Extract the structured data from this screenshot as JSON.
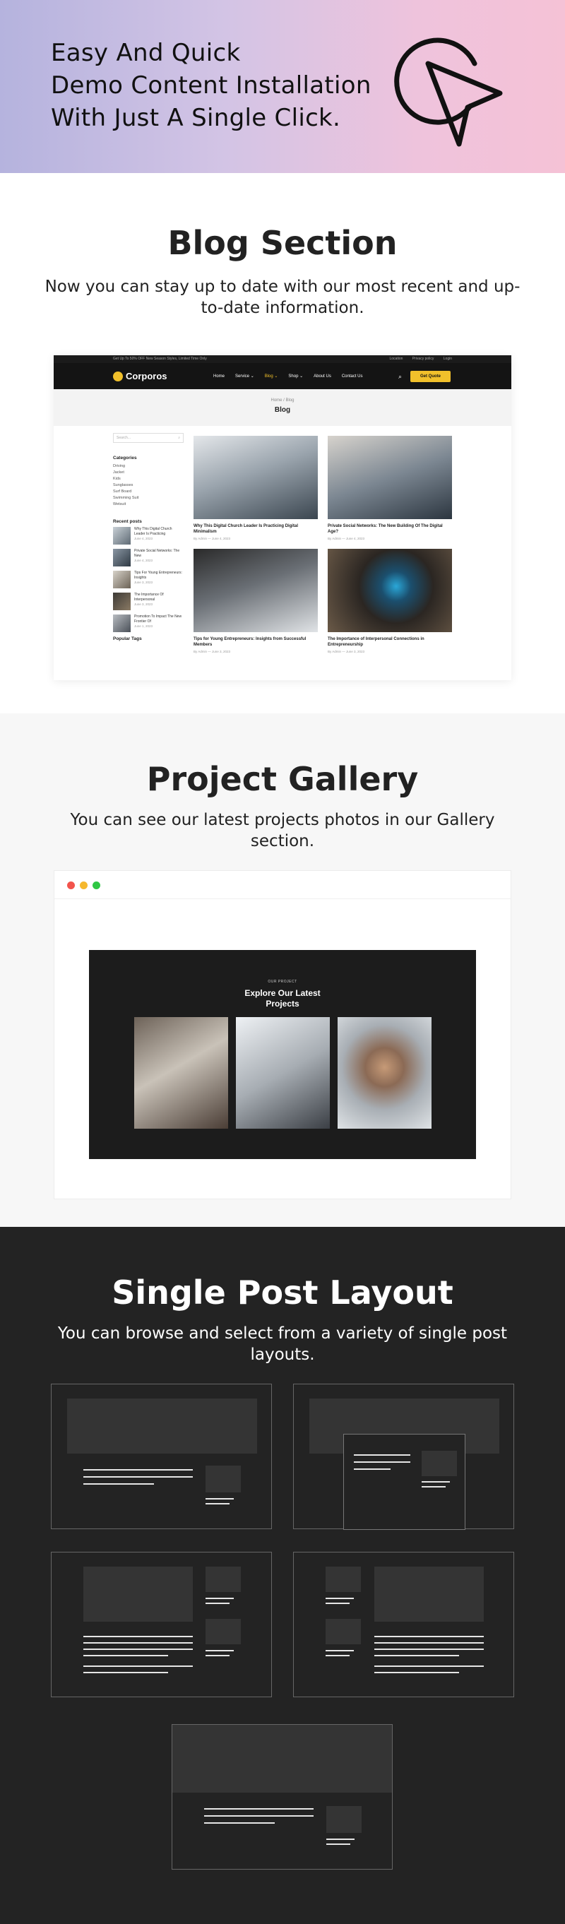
{
  "hero": {
    "title_lines": [
      "Easy And Quick",
      "Demo Content Installation",
      "With Just A Single Click."
    ],
    "icon": "cursor-click-icon"
  },
  "blog_section": {
    "title": "Blog Section",
    "subtitle": "Now you can stay up to date with our most recent and up-to-date information.",
    "preview": {
      "topbar_left": "Get Up To 50% OFF New Season Styles, Limited Time Only",
      "topbar_links": [
        "Location",
        "Privacy policy",
        "Login"
      ],
      "logo": "Corporos",
      "nav": [
        "Home",
        "Service ⌄",
        "Blog ⌄",
        "Shop ⌄",
        "About Us",
        "Contact Us"
      ],
      "nav_active": "Blog ⌄",
      "cta": "Get Quote",
      "breadcrumb": "Home / Blog",
      "page_title": "Blog",
      "search_placeholder": "Search...",
      "categories_title": "Categories",
      "categories": [
        "Driving",
        "Jacket",
        "Kids",
        "Sunglasses",
        "Surf Board",
        "Swimming Suit",
        "Wetsuit"
      ],
      "recent_title": "Recent posts",
      "recent_posts": [
        {
          "title": "Why This Digital Church Leader Is Practicing",
          "date": "June 4, 2023"
        },
        {
          "title": "Private Social Networks: The New",
          "date": "June 4, 2023"
        },
        {
          "title": "Tips For Young Entrepreneurs: Insights",
          "date": "June 3, 2023"
        },
        {
          "title": "The Importance Of Interpersonal",
          "date": "June 3, 2023"
        },
        {
          "title": "Promotion To Impact The New Frontier Of",
          "date": "June 1, 2023"
        }
      ],
      "popular_title": "Popular Tags",
      "posts": [
        {
          "title": "Why This Digital Church Leader Is Practicing Digital Minimalism",
          "meta": "By Admin — June 4, 2023"
        },
        {
          "title": "Private Social Networks: The New Building Of The Digital Age?",
          "meta": "By Admin — June 4, 2023"
        },
        {
          "title": "Tips for Young Entrepreneurs: Insights from Successful Members",
          "meta": "By Admin — June 3, 2023"
        },
        {
          "title": "The Importance of Interpersonal Connections in Entrepreneurship",
          "meta": "By Admin — June 3, 2023"
        }
      ]
    }
  },
  "gallery_section": {
    "title": "Project Gallery",
    "subtitle": "You can see our latest projects photos in our Gallery section.",
    "preview": {
      "kicker": "OUR PROJECT",
      "heading_lines": [
        "Explore Our Latest",
        "Projects"
      ]
    },
    "colors": {
      "close": "#f2544c",
      "minimize": "#f5b82e",
      "maximize": "#2fc744"
    }
  },
  "single_post_section": {
    "title": "Single Post Layout",
    "subtitle": "You can browse and select from a variety of single post layouts."
  }
}
